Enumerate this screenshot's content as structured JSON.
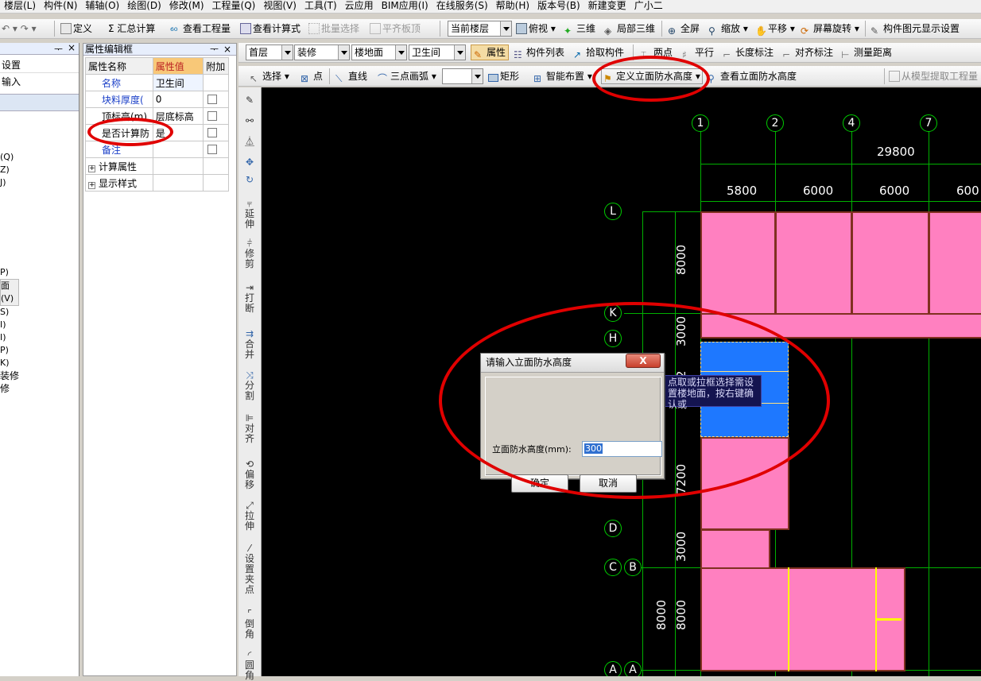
{
  "menu": [
    "楼层(L)",
    "构件(N)",
    "辅轴(O)",
    "绘图(D)",
    "修改(M)",
    "工程量(Q)",
    "视图(V)",
    "工具(T)",
    "云应用",
    "BIM应用(I)",
    "在线服务(S)",
    "帮助(H)",
    "版本号(B)",
    "新建变更",
    "广小二"
  ],
  "toolbar1": {
    "define": "定义",
    "sum": "汇总计算",
    "view_qty": "查看工程量",
    "view_formula": "查看计算式",
    "batch_select": "批量选择",
    "align_slab": "平齐板顶",
    "floor_scope": "当前楼层",
    "top_view": "俯视",
    "three_d": "三维",
    "local_3d": "局部三维",
    "fullscreen": "全屏",
    "zoom": "缩放",
    "pan": "平移",
    "screen_rotate": "屏幕旋转",
    "display_setting": "构件图元显示设置"
  },
  "toolbar2": {
    "floor": "首层",
    "category": "装修",
    "type": "楼地面",
    "component": "卫生间",
    "property": "属性",
    "comp_list": "构件列表",
    "pick": "拾取构件",
    "two_point": "两点",
    "parallel": "平行",
    "len_dim": "长度标注",
    "align_dim": "对齐标注",
    "measure": "测量距离"
  },
  "toolbar3": {
    "select": "选择",
    "point": "点",
    "line": "直线",
    "arc": "三点画弧",
    "rect": "矩形",
    "smart": "智能布置",
    "define_wp": "定义立面防水高度",
    "view_wp": "查看立面防水高度",
    "extract": "从模型提取工程量"
  },
  "left_panel": {
    "items": [
      "设置",
      "输入"
    ],
    "frag": [
      "(Q)",
      "Z)",
      "J)",
      "P)",
      "面(V)",
      "S)",
      "I)",
      "I)",
      "P)",
      "K)",
      "装修",
      "修"
    ]
  },
  "prop_panel": {
    "title": "属性编辑框",
    "headers": [
      "属性名称",
      "属性值",
      "附加"
    ],
    "rows": [
      {
        "name": "名称",
        "value": "卫生间",
        "check": false,
        "blue": true
      },
      {
        "name": "块料厚度(",
        "value": "0",
        "check": true,
        "blue": true
      },
      {
        "name": "顶标高(m)",
        "value": "层底标高",
        "check": true,
        "blue": false
      },
      {
        "name": "是否计算防",
        "value": "是",
        "check": true,
        "blue": false
      },
      {
        "name": "备注",
        "value": "",
        "check": true,
        "blue": true
      },
      {
        "name": "计算属性",
        "value": "",
        "check": false,
        "blue": false
      },
      {
        "name": "显示样式",
        "value": "",
        "check": false,
        "blue": false
      }
    ]
  },
  "vtools": [
    "延伸",
    "修剪",
    "打断",
    "合并",
    "分割",
    "对齐",
    "偏移",
    "拉伸",
    "设置夹点",
    "倒角",
    "圆角"
  ],
  "grid": {
    "top_axes": [
      "1",
      "2",
      "4",
      "7"
    ],
    "left_axes": [
      "L",
      "K",
      "H",
      "D",
      "C",
      "B",
      "A",
      "A"
    ],
    "total": "29800",
    "spans": [
      "5800",
      "6000",
      "6000",
      "600"
    ],
    "vdims": [
      "8000",
      "3000",
      "2",
      "7200",
      "3000",
      "8000",
      "8000"
    ]
  },
  "tooltip": "点取或拉框选择需设置楼地面，按右键确认或",
  "dialog": {
    "title": "请输入立面防水高度",
    "label": "立面防水高度(mm):",
    "value": "300",
    "ok": "确定",
    "cancel": "取消",
    "close": "X"
  }
}
